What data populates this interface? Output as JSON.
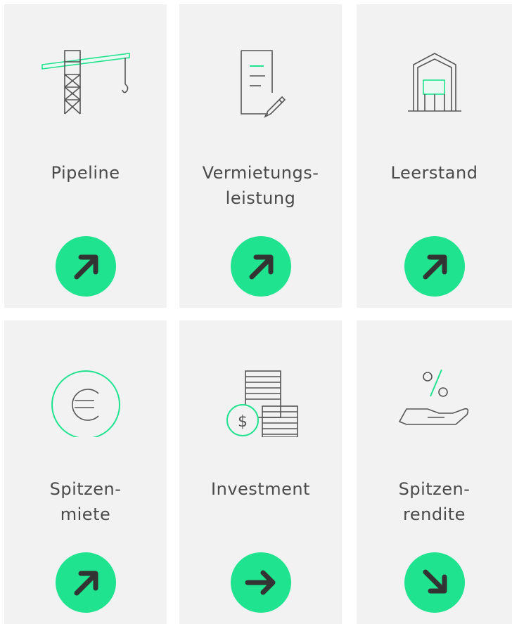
{
  "colors": {
    "accent": "#20e38f",
    "card_bg": "#f2f2f2",
    "text": "#4a4a4a",
    "line_art": "#555555"
  },
  "cards": [
    {
      "label": "Pipeline",
      "icon": "crane-icon",
      "trend": "up"
    },
    {
      "label": "Vermietungs-\nleistung",
      "icon": "contract-pen-icon",
      "trend": "up"
    },
    {
      "label": "Leerstand",
      "icon": "warehouse-icon",
      "trend": "up"
    },
    {
      "label": "Spitzen-\nmiete",
      "icon": "euro-coin-icon",
      "trend": "up"
    },
    {
      "label": "Investment",
      "icon": "coin-stacks-icon",
      "trend": "flat"
    },
    {
      "label": "Spitzen-\nrendite",
      "icon": "hand-percent-icon",
      "trend": "down"
    }
  ]
}
